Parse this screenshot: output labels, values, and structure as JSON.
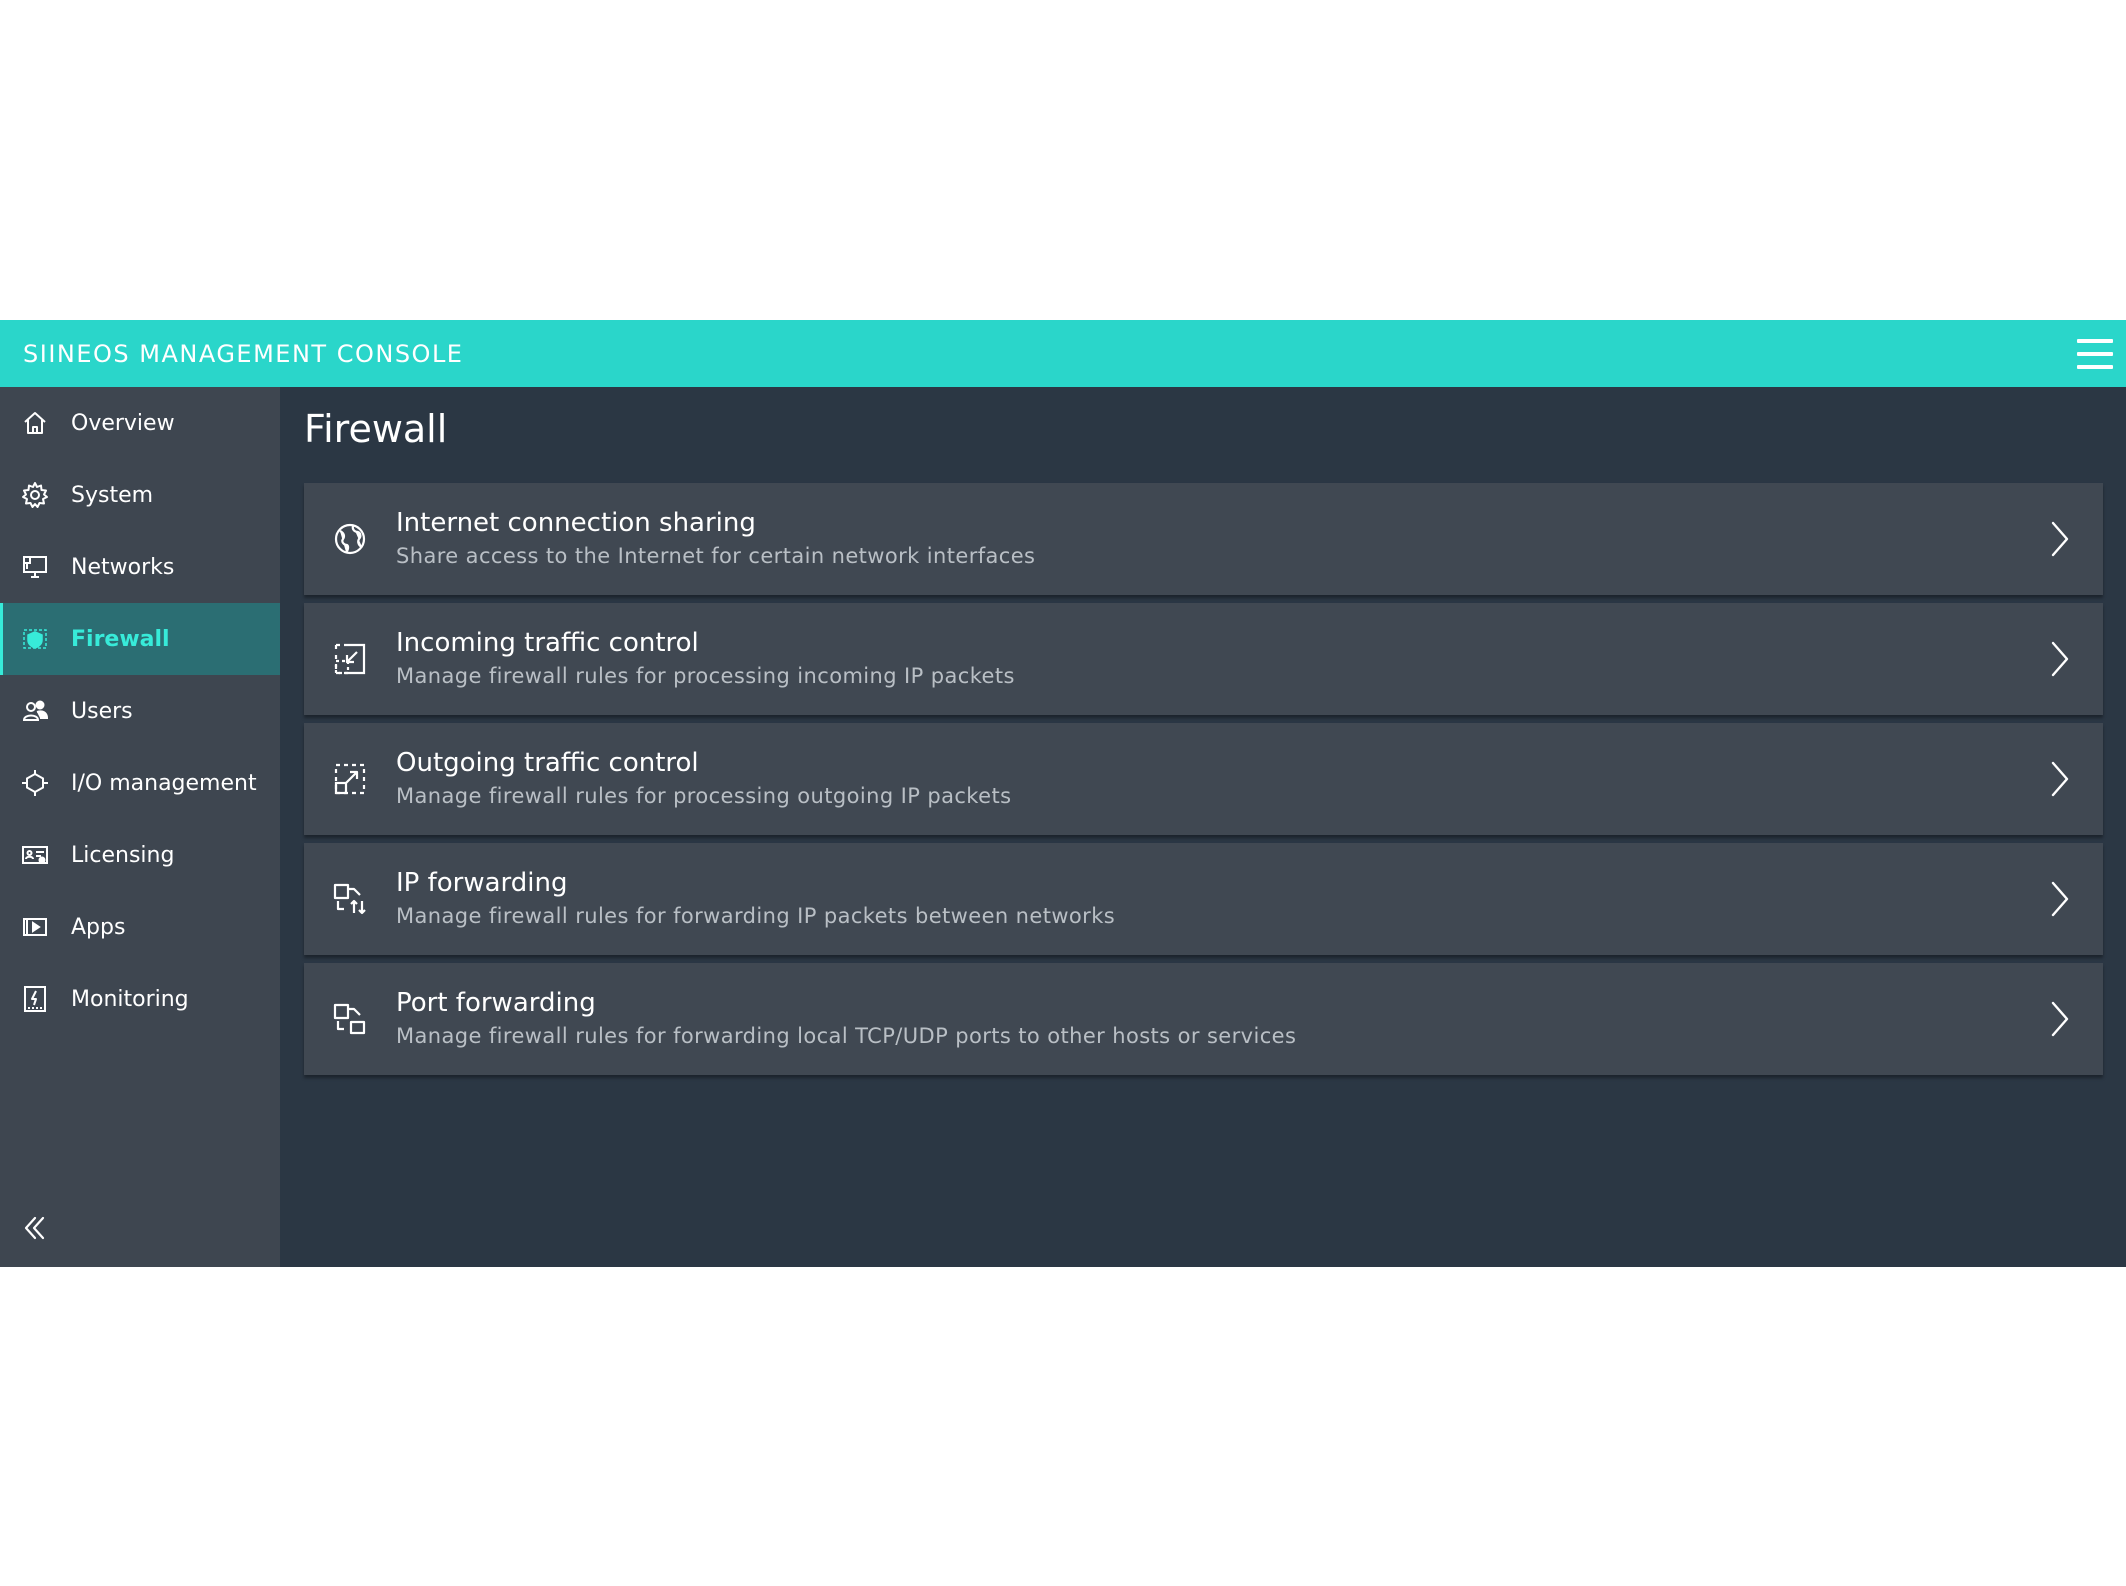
{
  "header": {
    "title": "SIINEOS MANAGEMENT CONSOLE",
    "menu_icon": "hamburger-menu-icon"
  },
  "sidebar": {
    "active": "Firewall",
    "items": [
      {
        "label": "Overview",
        "icon": "home-icon"
      },
      {
        "label": "System",
        "icon": "gear-icon"
      },
      {
        "label": "Networks",
        "icon": "monitor-network-icon"
      },
      {
        "label": "Firewall",
        "icon": "firewall-icon"
      },
      {
        "label": "Users",
        "icon": "users-icon"
      },
      {
        "label": "I/O management",
        "icon": "io-icon"
      },
      {
        "label": "Licensing",
        "icon": "license-icon"
      },
      {
        "label": "Apps",
        "icon": "apps-icon"
      },
      {
        "label": "Monitoring",
        "icon": "monitoring-icon"
      }
    ],
    "collapse_icon": "double-chevron-left-icon"
  },
  "main": {
    "title": "Firewall",
    "cards": [
      {
        "title": "Internet connection sharing",
        "subtitle": "Share access to the Internet for certain network interfaces",
        "icon": "globe-icon"
      },
      {
        "title": "Incoming traffic control",
        "subtitle": "Manage firewall rules for processing incoming IP packets",
        "icon": "incoming-arrow-icon"
      },
      {
        "title": "Outgoing traffic control",
        "subtitle": "Manage firewall rules for processing outgoing IP packets",
        "icon": "outgoing-arrow-icon"
      },
      {
        "title": "IP forwarding",
        "subtitle": "Manage firewall rules for forwarding IP packets between networks",
        "icon": "ip-forwarding-icon"
      },
      {
        "title": "Port forwarding",
        "subtitle": "Manage firewall rules for forwarding local TCP/UDP ports to other hosts or services",
        "icon": "port-forwarding-icon"
      }
    ]
  },
  "colors": {
    "accent": "#2ad6ca",
    "active_text": "#37ebd9",
    "background": "#2b3744",
    "sidebar": "#3e4650",
    "card": "#404852"
  }
}
